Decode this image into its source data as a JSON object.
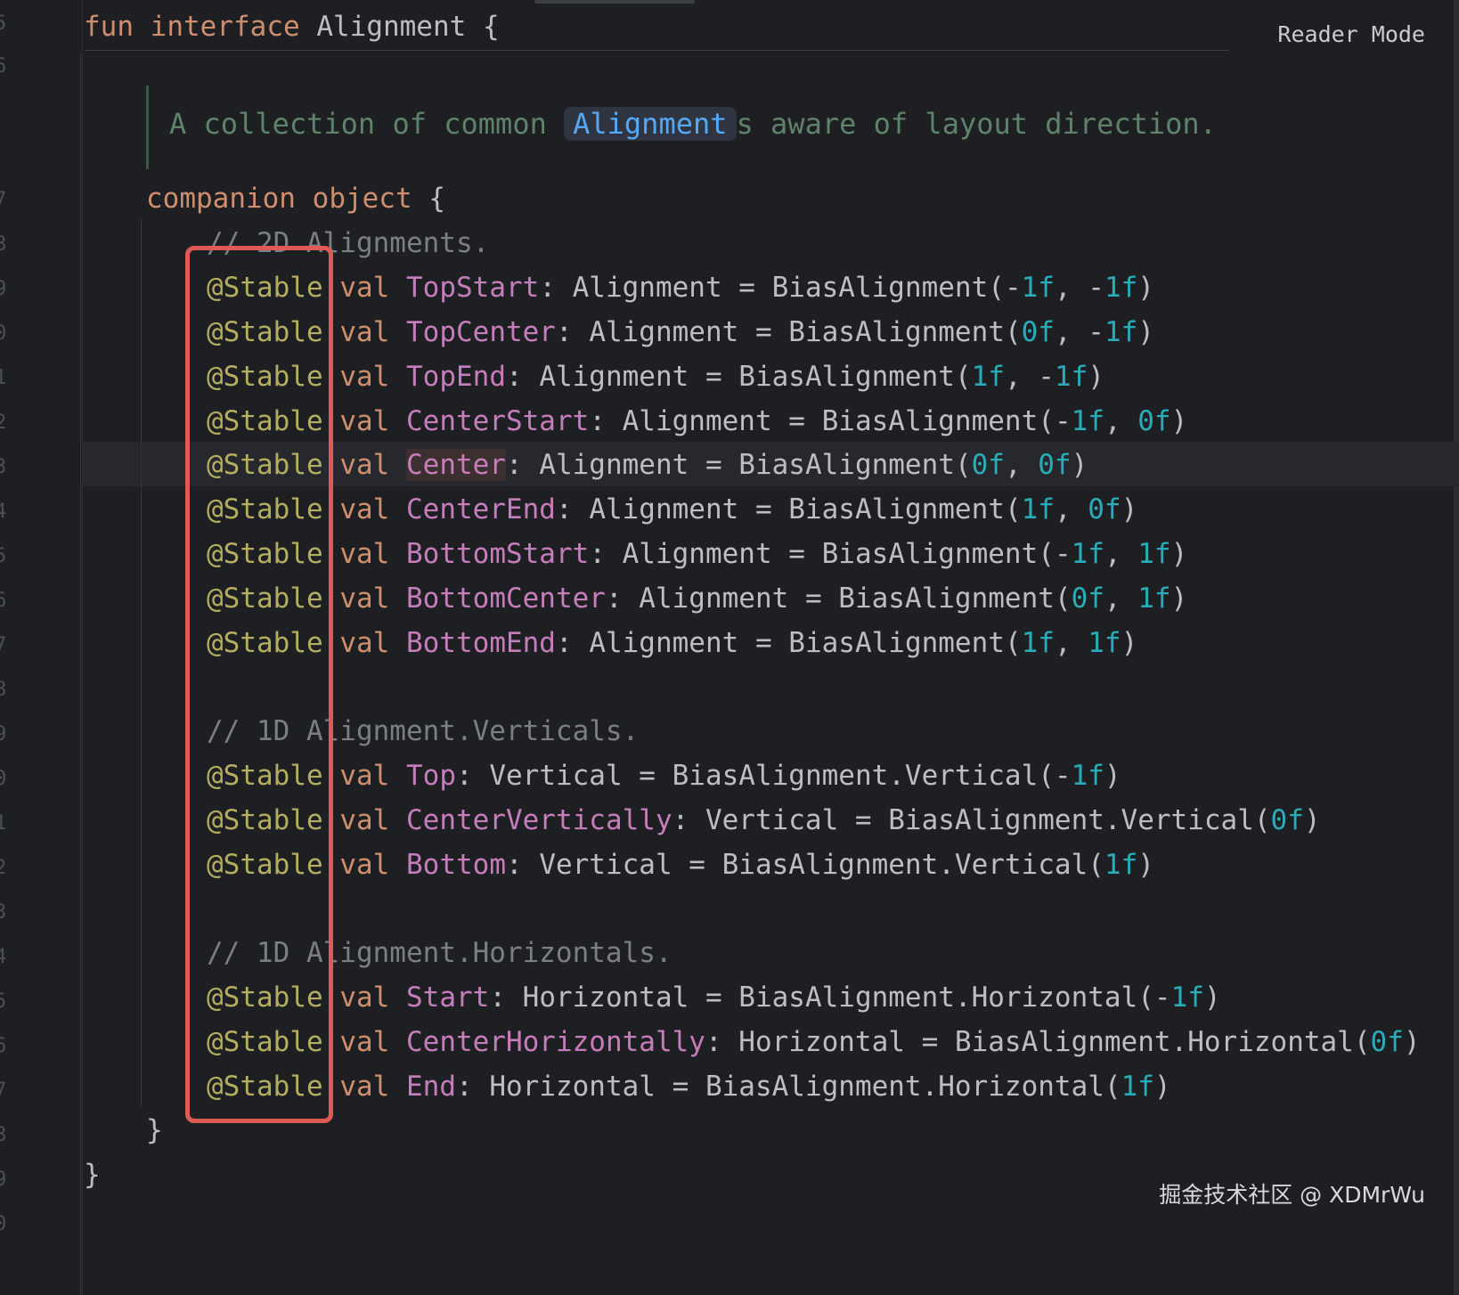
{
  "reader_mode_label": "Reader Mode",
  "watermark": "掘金技术社区 @ XDMrWu",
  "gutter": [
    "5",
    "6",
    "7",
    "8",
    "9",
    "0",
    "1",
    "2",
    "3",
    "4",
    "5",
    "6",
    "7",
    "8",
    "9",
    "0",
    "1",
    "2",
    "3",
    "4",
    "5",
    "6",
    "7",
    "8",
    "9",
    "0"
  ],
  "header": {
    "fun": "fun",
    "interface": "interface",
    "name": "Alignment",
    "brace": "{"
  },
  "doc": {
    "prefix": "A collection of common ",
    "link": "Alignment",
    "suffix": "s aware of layout direction."
  },
  "companion": {
    "kw1": "companion",
    "kw2": "object",
    "brace": "{"
  },
  "lines": {
    "c1": "// 2D Alignments.",
    "c2": "// 1D Alignment.Verticals.",
    "c3": "// 1D Alignment.Horizontals.",
    "annotation": "@Stable",
    "val": "val",
    "close_inner": "}",
    "close_outer": "}"
  },
  "props": [
    {
      "name": "TopStart",
      "type": "Alignment",
      "fn": "BiasAlignment",
      "args": [
        "-",
        "1f",
        ", -",
        "1f"
      ]
    },
    {
      "name": "TopCenter",
      "type": "Alignment",
      "fn": "BiasAlignment",
      "args": [
        "",
        "0f",
        ", -",
        "1f"
      ]
    },
    {
      "name": "TopEnd",
      "type": "Alignment",
      "fn": "BiasAlignment",
      "args": [
        "",
        "1f",
        ", -",
        "1f"
      ]
    },
    {
      "name": "CenterStart",
      "type": "Alignment",
      "fn": "BiasAlignment",
      "args": [
        "-",
        "1f",
        ", ",
        "0f"
      ]
    },
    {
      "name": "Center",
      "type": "Alignment",
      "fn": "BiasAlignment",
      "args": [
        "",
        "0f",
        ", ",
        "0f"
      ]
    },
    {
      "name": "CenterEnd",
      "type": "Alignment",
      "fn": "BiasAlignment",
      "args": [
        "",
        "1f",
        ", ",
        "0f"
      ]
    },
    {
      "name": "BottomStart",
      "type": "Alignment",
      "fn": "BiasAlignment",
      "args": [
        "-",
        "1f",
        ", ",
        "1f"
      ]
    },
    {
      "name": "BottomCenter",
      "type": "Alignment",
      "fn": "BiasAlignment",
      "args": [
        "",
        "0f",
        ", ",
        "1f"
      ]
    },
    {
      "name": "BottomEnd",
      "type": "Alignment",
      "fn": "BiasAlignment",
      "args": [
        "",
        "1f",
        ", ",
        "1f"
      ]
    },
    {
      "name": "Top",
      "type": "Vertical",
      "fn": "BiasAlignment.Vertical",
      "args": [
        "-",
        "1f"
      ]
    },
    {
      "name": "CenterVertically",
      "type": "Vertical",
      "fn": "BiasAlignment.Vertical",
      "args": [
        "",
        "0f"
      ]
    },
    {
      "name": "Bottom",
      "type": "Vertical",
      "fn": "BiasAlignment.Vertical",
      "args": [
        "",
        "1f"
      ]
    },
    {
      "name": "Start",
      "type": "Horizontal",
      "fn": "BiasAlignment.Horizontal",
      "args": [
        "-",
        "1f"
      ]
    },
    {
      "name": "CenterHorizontally",
      "type": "Horizontal",
      "fn": "BiasAlignment.Horizontal",
      "args": [
        "",
        "0f"
      ]
    },
    {
      "name": "End",
      "type": "Horizontal",
      "fn": "BiasAlignment.Horizontal",
      "args": [
        "",
        "1f"
      ]
    }
  ]
}
